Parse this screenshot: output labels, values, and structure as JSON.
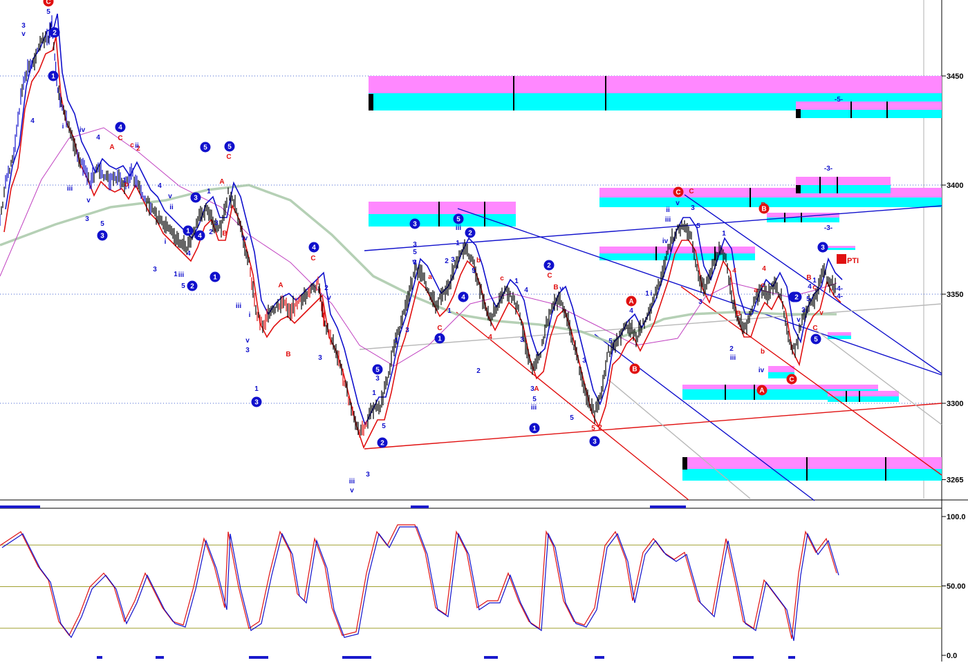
{
  "chart_data": {
    "type": "line",
    "price_panel": {
      "yaxis_ticks": [
        {
          "value": 3450,
          "label": "3450"
        },
        {
          "value": 3400,
          "label": "3400"
        },
        {
          "value": 3350,
          "label": "3350"
        },
        {
          "value": 3300,
          "label": "3300"
        },
        {
          "value": 3265,
          "label": "3265"
        }
      ],
      "ylim": [
        3265,
        3480
      ],
      "guide_lines": [
        3450,
        3400,
        3350,
        3300
      ],
      "annotation": "PTI",
      "series": [
        {
          "color": "#000000",
          "role": "price"
        },
        {
          "color": "#1010cc",
          "role": "upper-band"
        },
        {
          "color": "#e01010",
          "role": "lower-band"
        },
        {
          "color": "#c040c0",
          "role": "moving-average"
        },
        {
          "color": "#a8c8a8",
          "role": "slow-moving-average"
        }
      ],
      "band_labels": [
        "-5-",
        "-3-",
        "-3-",
        "-4-",
        "-4-"
      ]
    },
    "oscillator_panel": {
      "yaxis_ticks": [
        {
          "value": 100,
          "label": "100.0"
        },
        {
          "value": 50,
          "label": "50.00"
        },
        {
          "value": 0,
          "label": "0.0"
        }
      ],
      "ylim": [
        0,
        100
      ],
      "guide_lines": [
        80,
        50,
        20
      ],
      "series": [
        {
          "color": "#e01010",
          "role": "%K"
        },
        {
          "color": "#1010cc",
          "role": "%D"
        }
      ]
    },
    "wave_labels": {
      "red": [
        "C",
        "A",
        "C",
        "b",
        "c",
        "2",
        "A",
        "B",
        "C",
        "A",
        "B",
        "C",
        "a",
        "C",
        "b",
        "4",
        "c",
        "C",
        "A",
        "B",
        "5",
        "2",
        "C",
        "B",
        "B",
        "a",
        "c",
        "b",
        "4",
        "4",
        "B",
        "c",
        "C",
        "v"
      ],
      "blue": [
        "3",
        "v",
        "5",
        "4",
        "i",
        "iii",
        "iv",
        "4",
        "v",
        "3",
        "5",
        "ii",
        "4",
        "1",
        "i",
        "iii",
        "5",
        "v",
        "3",
        "4",
        "1",
        "ii",
        "1",
        "2",
        "3",
        "iii",
        "iv",
        "v",
        "3",
        "i",
        "1",
        "2",
        "v",
        "3",
        "iii",
        "v",
        "3",
        "1",
        "3",
        "5",
        "1",
        "3",
        "5",
        "v",
        "3",
        "3",
        "2",
        "1",
        "3",
        "1",
        "iii",
        "5",
        "2",
        "1",
        "3",
        "4",
        "3",
        "5",
        "iii",
        "v",
        "5",
        "3",
        "5",
        "4",
        "1",
        "i",
        "ii",
        "iii",
        "iv",
        "v",
        "3",
        "5",
        "3",
        "1",
        "2",
        "iii",
        "iv",
        "v",
        "3",
        "4",
        "1",
        "5"
      ],
      "circled_blue": [
        "1",
        "2",
        "3",
        "4",
        "5",
        "3",
        "4",
        "1",
        "2",
        "5",
        "3",
        "4",
        "1",
        "2",
        "5",
        "3",
        "1",
        "2",
        "4",
        "5",
        "1",
        "2",
        "3",
        "4",
        "3",
        "5",
        "1",
        "2",
        "3"
      ],
      "circled_red": [
        "C",
        "C",
        "A",
        "B",
        "B",
        "A",
        "C"
      ]
    }
  }
}
